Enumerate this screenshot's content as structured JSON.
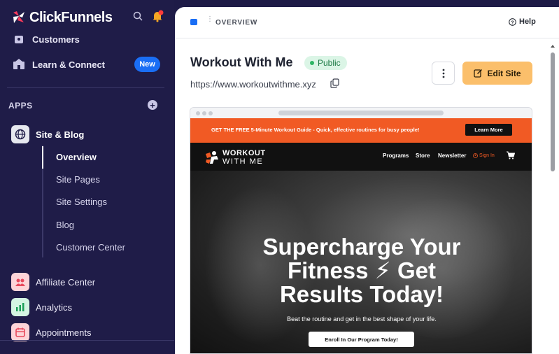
{
  "brand": {
    "name": "ClickFunnels"
  },
  "sidebar": {
    "customers_label": "Customers",
    "learn_label": "Learn & Connect",
    "new_badge": "New",
    "apps_title": "APPS",
    "site_blog": {
      "label": "Site & Blog",
      "items": [
        {
          "label": "Overview",
          "active": true
        },
        {
          "label": "Site Pages"
        },
        {
          "label": "Site Settings"
        },
        {
          "label": "Blog"
        },
        {
          "label": "Customer Center"
        }
      ]
    },
    "apps": [
      {
        "label": "Affiliate Center",
        "icon": "affiliate-icon"
      },
      {
        "label": "Analytics",
        "icon": "analytics-icon"
      },
      {
        "label": "Appointments",
        "icon": "calendar-icon"
      }
    ]
  },
  "topbar": {
    "breadcrumb": "OVERVIEW",
    "help": "Help"
  },
  "site": {
    "title": "Workout With Me",
    "status": "Public",
    "url": "https://www.workoutwithme.xyz",
    "edit_label": "Edit Site"
  },
  "preview": {
    "promo_text": "GET THE FREE 5-Minute Workout Guide - Quick, effective routines for busy people!",
    "promo_button": "Learn More",
    "logo_line1": "WORKOUT",
    "logo_line2": "WITH ME",
    "nav": [
      "Programs",
      "Store",
      "Newsletter"
    ],
    "sign_in": "Sign In",
    "hero_title_1": "Supercharge Your",
    "hero_title_2": "Fitness ⚡ Get",
    "hero_title_3": "Results Today!",
    "hero_sub": "Beat the routine and get in the best shape of your life.",
    "hero_button": "Enroll In Our Program Today!"
  },
  "colors": {
    "sidebar_bg": "#1f1c48",
    "accent_blue": "#1a6ef5",
    "edit_button": "#fbbf6b",
    "promo_orange": "#f15a24",
    "public_green": "#2db665"
  }
}
